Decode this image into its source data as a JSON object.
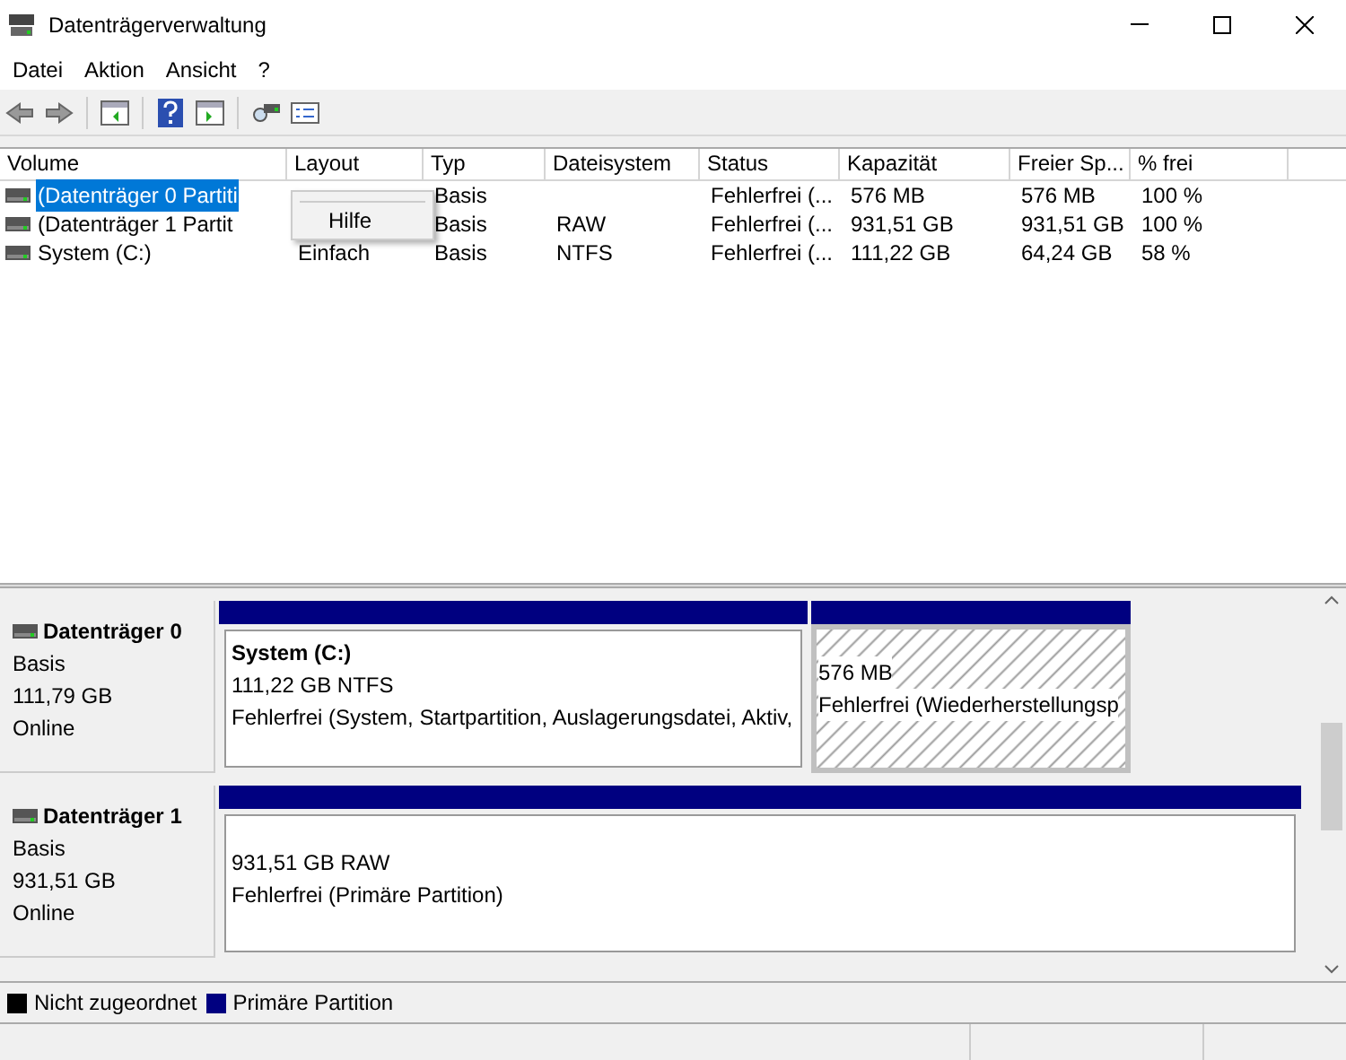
{
  "window": {
    "title": "Datenträgerverwaltung"
  },
  "menu": [
    "Datei",
    "Aktion",
    "Ansicht",
    "?"
  ],
  "table": {
    "columns": [
      "Volume",
      "Layout",
      "Typ",
      "Dateisystem",
      "Status",
      "Kapazität",
      "Freier Sp...",
      "% frei"
    ],
    "rows": [
      {
        "selected": true,
        "cells": [
          "(Datenträger 0 Partiti",
          "",
          "Basis",
          "",
          "Fehlerfrei (...",
          "576 MB",
          "576 MB",
          "100 %"
        ]
      },
      {
        "selected": false,
        "cells": [
          "(Datenträger 1 Partit",
          "",
          "Basis",
          "RAW",
          "Fehlerfrei (...",
          "931,51 GB",
          "931,51 GB",
          "100 %"
        ]
      },
      {
        "selected": false,
        "cells": [
          "System (C:)",
          "Einfach",
          "Basis",
          "NTFS",
          "Fehlerfrei (...",
          "111,22 GB",
          "64,24 GB",
          "58 %"
        ]
      }
    ]
  },
  "context_menu": {
    "items": [
      "Hilfe"
    ]
  },
  "disks": [
    {
      "name": "Datenträger 0",
      "type": "Basis",
      "size": "111,79 GB",
      "status": "Online",
      "partitions": [
        {
          "selected": false,
          "title": "System  (C:)",
          "size": "111,22 GB NTFS",
          "status": "Fehlerfrei (System, Startpartition, Auslagerungsdatei, Aktiv,"
        },
        {
          "selected": true,
          "size": "576 MB",
          "status": "Fehlerfrei (Wiederherstellungsp"
        }
      ]
    },
    {
      "name": "Datenträger 1",
      "type": "Basis",
      "size": "931,51 GB",
      "status": "Online",
      "partitions": [
        {
          "selected": false,
          "size": "931,51 GB RAW",
          "status": "Fehlerfrei (Primäre Partition)"
        }
      ]
    }
  ],
  "legend": [
    {
      "label": "Nicht zugeordnet",
      "color": "#000000"
    },
    {
      "label": "Primäre Partition",
      "color": "#000080"
    }
  ]
}
